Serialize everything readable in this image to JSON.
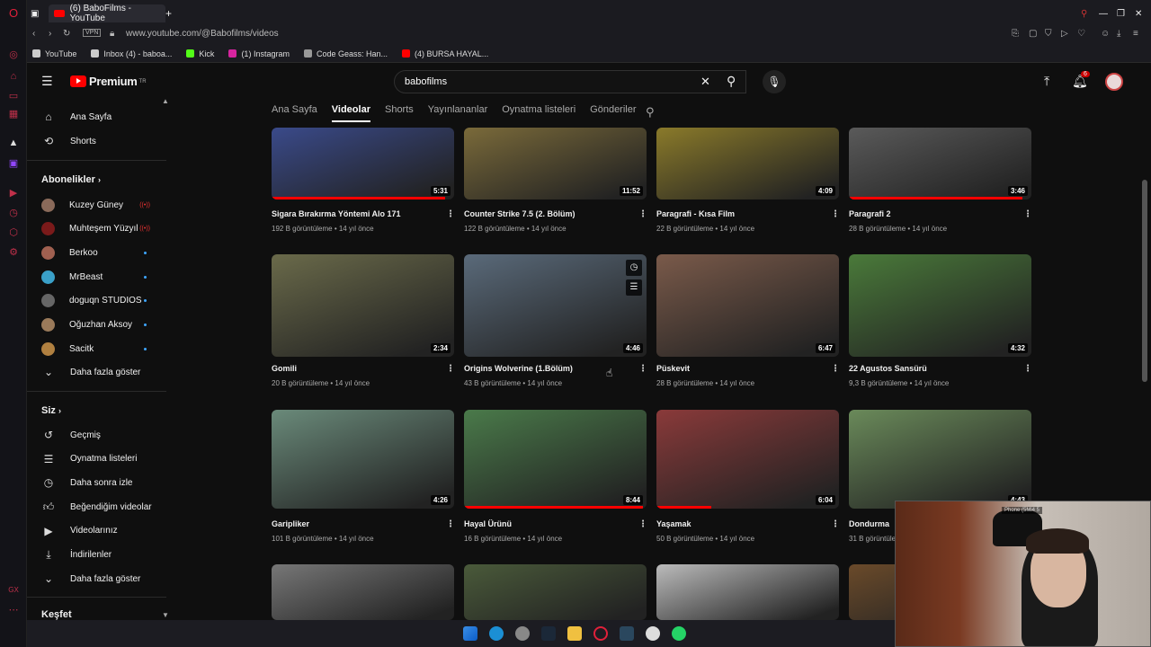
{
  "browser": {
    "tab_title": "(6) BaboFilms - YouTube",
    "url": "www.youtube.com/@Babofilms/videos",
    "vpn_label": "VPN",
    "bookmarks": [
      "YouTube",
      "Inbox (4) - baboa...",
      "Kick",
      "(1) Instagram",
      "Code Geass: Han...",
      "(4) BURSA HAYAL..."
    ]
  },
  "header": {
    "logo_text": "Premium",
    "logo_sup": "TR",
    "search_value": "babofilms",
    "notif_count": "6"
  },
  "sidebar": {
    "main": [
      {
        "label": "Ana Sayfa",
        "icon": "home-icon"
      },
      {
        "label": "Shorts",
        "icon": "shorts-icon"
      }
    ],
    "subs_header": "Abonelikler",
    "subs": [
      {
        "label": "Kuzey Güney",
        "live": true,
        "color": "#8a6a5a"
      },
      {
        "label": "Muhteşem Yüzyıl",
        "live": true,
        "color": "#7a1a1a"
      },
      {
        "label": "Berkoo",
        "live": false,
        "color": "#a06050"
      },
      {
        "label": "MrBeast",
        "live": false,
        "color": "#3aa0c8"
      },
      {
        "label": "doguqn STUDIOS",
        "live": false,
        "color": "#666"
      },
      {
        "label": "Oğuzhan Aksoy",
        "live": false,
        "color": "#9a7a5a"
      },
      {
        "label": "Sacitk",
        "live": false,
        "color": "#b08040"
      }
    ],
    "subs_more": "Daha fazla göster",
    "you_header": "Siz",
    "you": [
      {
        "label": "Geçmiş",
        "icon": "history-icon"
      },
      {
        "label": "Oynatma listeleri",
        "icon": "playlist-icon"
      },
      {
        "label": "Daha sonra izle",
        "icon": "clock-icon"
      },
      {
        "label": "Beğendiğim videolar",
        "icon": "like-icon"
      },
      {
        "label": "Videolarınız",
        "icon": "video-icon"
      },
      {
        "label": "İndirilenler",
        "icon": "download-icon"
      }
    ],
    "you_more": "Daha fazla göster",
    "explore_header": "Keşfet"
  },
  "channel_tabs": [
    "Ana Sayfa",
    "Videolar",
    "Shorts",
    "Yayınlananlar",
    "Oynatma listeleri",
    "Gönderiler"
  ],
  "active_tab": "Videolar",
  "videos": [
    {
      "title": "Sigara Bırakırma Yöntemi Alo 171",
      "meta": "192 B görüntüleme • 14 yıl önce",
      "duration": "5:31",
      "watched": 0.95,
      "color": "#3a4a8a"
    },
    {
      "title": "Counter Strike 7.5 (2. Bölüm)",
      "meta": "122 B görüntüleme • 14 yıl önce",
      "duration": "11:52",
      "watched": 0,
      "color": "#7a6a3a"
    },
    {
      "title": "Paragrafi - Kısa Film",
      "meta": "22 B görüntüleme • 14 yıl önce",
      "duration": "4:09",
      "watched": 0,
      "color": "#8a7a2a"
    },
    {
      "title": "Paragrafi 2",
      "meta": "28 B görüntüleme • 14 yıl önce",
      "duration": "3:46",
      "watched": 0.95,
      "color": "#5a5a5a"
    },
    {
      "title": "Gomili",
      "meta": "20 B görüntüleme • 14 yıl önce",
      "duration": "2:34",
      "watched": 0,
      "color": "#6a6a4a"
    },
    {
      "title": "Origins Wolverine (1.Bölüm)",
      "meta": "43 B görüntüleme • 14 yıl önce",
      "duration": "4:46",
      "watched": 0,
      "color": "#5a6a7a"
    },
    {
      "title": "Püskevit",
      "meta": "28 B görüntüleme • 14 yıl önce",
      "duration": "6:47",
      "watched": 0,
      "color": "#7a5a4a"
    },
    {
      "title": "22 Agustos Sansürü",
      "meta": "9,3 B görüntüleme • 14 yıl önce",
      "duration": "4:32",
      "watched": 0,
      "color": "#4a7a3a"
    },
    {
      "title": "Garipliker",
      "meta": "101 B görüntüleme • 14 yıl önce",
      "duration": "4:26",
      "watched": 0,
      "color": "#6a8a7a"
    },
    {
      "title": "Hayal Ürünü",
      "meta": "16 B görüntüleme • 14 yıl önce",
      "duration": "8:44",
      "watched": 0.98,
      "color": "#4a7a4a"
    },
    {
      "title": "Yaşamak",
      "meta": "50 B görüntüleme • 14 yıl önce",
      "duration": "6:04",
      "watched": 0.3,
      "color": "#8a3a3a"
    },
    {
      "title": "Dondurma",
      "meta": "31 B görüntüleme • 14 yıl önce",
      "duration": "4:43",
      "watched": 0,
      "color": "#6a8a5a"
    },
    {
      "title": "",
      "meta": "",
      "duration": "",
      "watched": 0,
      "color": "#777"
    },
    {
      "title": "",
      "meta": "",
      "duration": "",
      "watched": 0,
      "color": "#4a5a3a"
    },
    {
      "title": "",
      "meta": "",
      "duration": "",
      "watched": 0,
      "color": "#bbbbbb"
    },
    {
      "title": "",
      "meta": "",
      "duration": "",
      "watched": 0,
      "color": "#6a4a2a"
    }
  ],
  "webcam_tag": "Phone (5Mi4 5"
}
